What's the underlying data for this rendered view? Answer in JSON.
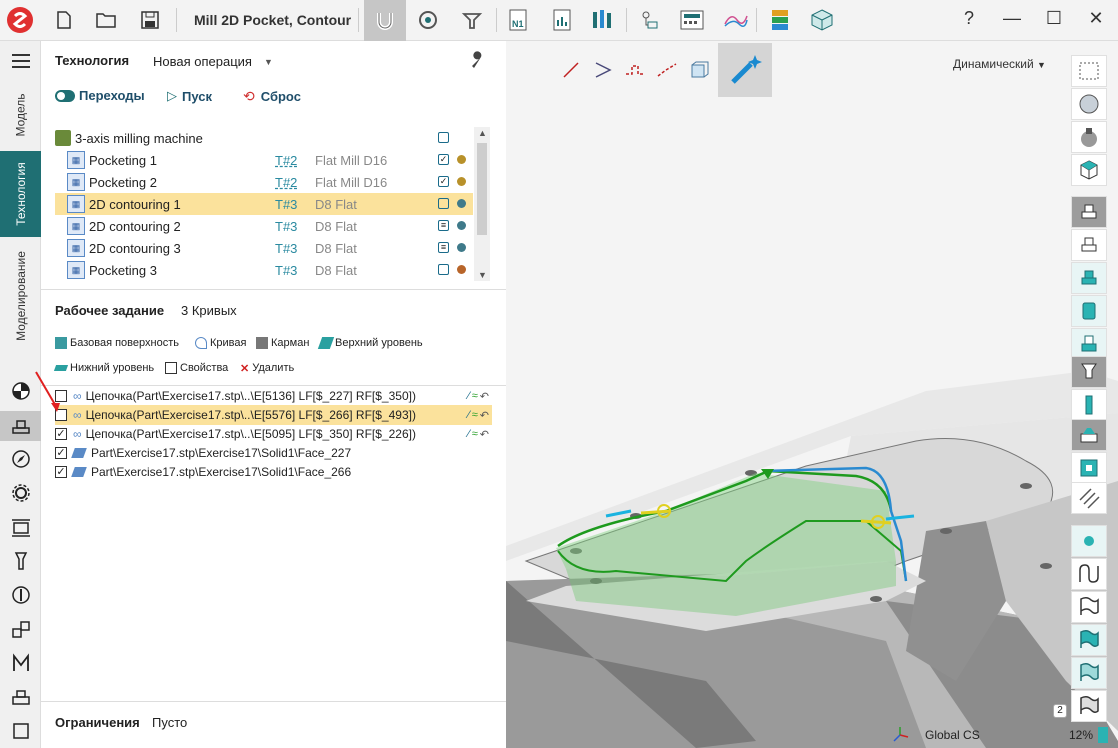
{
  "toolbar": {
    "doc_title": "Mill 2D Pocket, Contour",
    "icons": [
      "app-logo-icon",
      "new-file-icon",
      "open-folder-icon",
      "save-icon",
      "magnet-icon",
      "gauge-icon",
      "tool-holder-icon",
      "nc-program-icon",
      "report-icon",
      "tools-icon",
      "flow-icon",
      "postprocessor-icon",
      "chart-icon",
      "stack-icon",
      "package-icon"
    ],
    "help": "?",
    "minimize": "—",
    "maximize": "☐",
    "close": "✕"
  },
  "leftbar": {
    "tabs": [
      "Модель",
      "Технология",
      "Моделирование"
    ],
    "active_tab": "Технология"
  },
  "technology": {
    "title": "Технология",
    "operation_dropdown": "Новая операция",
    "transitions_label": "Переходы",
    "run_label": "Пуск",
    "reset_label": "Сброс",
    "machine": "3-axis milling machine",
    "operations": [
      {
        "name": "Pocketing 1",
        "tool": "T#2",
        "tool_name": "Flat Mill D16",
        "check": "✓",
        "dot": "#b8912a",
        "selected": false
      },
      {
        "name": "Pocketing 2",
        "tool": "T#2",
        "tool_name": "Flat Mill D16",
        "check": "✓",
        "dot": "#b8912a",
        "selected": false
      },
      {
        "name": "2D contouring 1",
        "tool": "T#3",
        "tool_name": "D8 Flat",
        "check": "",
        "dot": "#3f7a8a",
        "selected": true
      },
      {
        "name": "2D contouring 2",
        "tool": "T#3",
        "tool_name": "D8 Flat",
        "check": "≡",
        "dot": "#3f7a8a",
        "selected": false
      },
      {
        "name": "2D contouring 3",
        "tool": "T#3",
        "tool_name": "D8 Flat",
        "check": "≡",
        "dot": "#3f7a8a",
        "selected": false
      },
      {
        "name": "Pocketing 3",
        "tool": "T#3",
        "tool_name": "D8 Flat",
        "check": "",
        "dot": "#b8652a",
        "selected": false
      }
    ]
  },
  "workpiece": {
    "title": "Рабочее задание",
    "count": "3 Кривых",
    "buttons": {
      "base_surface": "Базовая поверхность",
      "curve": "Кривая",
      "pocket": "Карман",
      "top_level": "Верхний уровень",
      "bottom_level": "Нижний уровень",
      "properties": "Свойства",
      "delete": "Удалить"
    },
    "items": [
      {
        "checked": false,
        "text": "Цепочка(Part\\Exercise17.stp\\..\\E[5136] LF[$_227] RF[$_350])",
        "selected": false,
        "chain": true
      },
      {
        "checked": false,
        "text": "Цепочка(Part\\Exercise17.stp\\..\\E[5576] LF[$_266] RF[$_493])",
        "selected": true,
        "chain": true
      },
      {
        "checked": true,
        "text": "Цепочка(Part\\Exercise17.stp\\..\\E[5095] LF[$_350] RF[$_226])",
        "selected": false,
        "chain": true
      },
      {
        "checked": true,
        "text": "Part\\Exercise17.stp\\Exercise17\\Solid1\\Face_227",
        "selected": false,
        "chain": false
      },
      {
        "checked": true,
        "text": "Part\\Exercise17.stp\\Exercise17\\Solid1\\Face_266",
        "selected": false,
        "chain": false
      }
    ]
  },
  "constraints": {
    "title": "Ограничения",
    "value": "Пусто"
  },
  "viewport": {
    "mode_dropdown": "Динамический",
    "cs_label": "Global CS",
    "zoom": "12%",
    "badge": "2"
  },
  "colors": {
    "accent": "#1f6f73",
    "selection": "#fbe29c",
    "toolpath_green": "#3a9a3a",
    "toolpath_blue": "#2a8ad0"
  }
}
